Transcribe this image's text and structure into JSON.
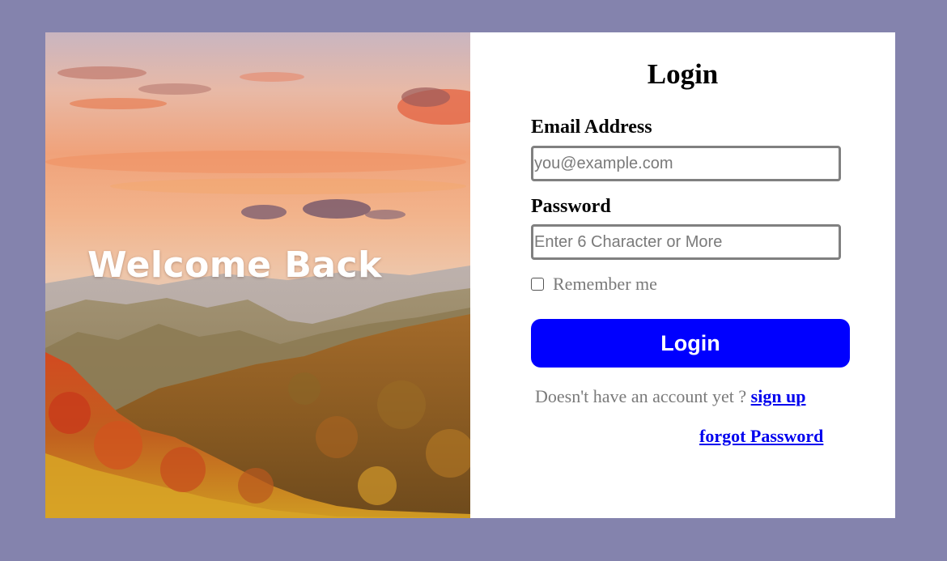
{
  "hero": {
    "title": "Welcome Back"
  },
  "login_form": {
    "title": "Login",
    "email": {
      "label": "Email Address",
      "value": "",
      "placeholder": "you@example.com"
    },
    "password": {
      "label": "Password",
      "value": "",
      "placeholder": "Enter 6 Character or More"
    },
    "remember_me": {
      "label": "Remember me",
      "checked": false
    },
    "submit_label": "Login",
    "signup_prompt": "Doesn't have an account yet ?",
    "signup_link": "sign up",
    "forgot_link": "forgot Password"
  },
  "colors": {
    "page_background": "#8483ad",
    "card_background": "#ffffff",
    "button_background": "#0000ff",
    "link": "#0000ee",
    "muted_text": "#7a7a7a"
  },
  "icons": {
    "remember_checkbox": "checkbox-unchecked-icon"
  }
}
